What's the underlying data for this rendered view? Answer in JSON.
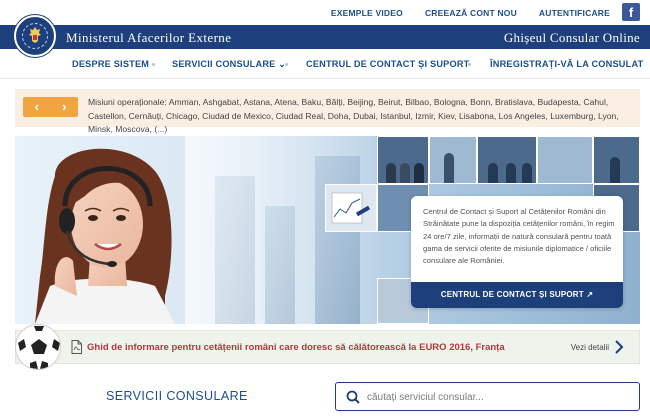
{
  "topbar": {
    "links": [
      "EXEMPLE VIDEO",
      "CREEAZĂ CONT NOU",
      "AUTENTIFICARE"
    ],
    "facebook_glyph": "f"
  },
  "header": {
    "ministry": "Ministerul Afacerilor Externe",
    "portal": "Ghișeul Consular Online",
    "crest_icon": "romanian-coat-of-arms",
    "crest_text": "GUVERNUL ROMÂNIEI"
  },
  "nav": {
    "items": [
      "DESPRE SISTEM",
      "SERVICII CONSULARE",
      "CENTRUL DE CONTACT ȘI SUPORT",
      "ÎNREGISTRAȚI-VĂ LA CONSULAT"
    ],
    "dropdown_glyph": "⌄"
  },
  "ticker": {
    "prev_glyph": "‹",
    "next_glyph": "›",
    "text": "Misiuni operaționale: Amman, Ashgabat, Astana, Atena, Baku, Bălți, Beijing, Beirut, Bilbao, Bologna, Bonn, Bratislava, Budapesta, Cahul, Castellon, Cernăuți, Chicago, Ciudad de Mexico, Ciudad Real, Doha, Dubai, Istanbul, Izmir, Kiev, Lisabona, Los Angeles, Luxemburg, Lyon, Minsk, Moscova, (...)"
  },
  "hero": {
    "card_text": "Centrul de Contact și Suport al Cetățenilor Români din Străinătate pune la dispoziția cetățenilor români, în regim 24 ore/7 zile, informații de natură consulară pentru toată gama de servicii oferite de misiunile diplomatice / oficiile consulare ale României.",
    "card_button": "CENTRUL DE CONTACT ȘI SUPORT",
    "external_glyph": "↗"
  },
  "guide": {
    "text": "Ghid de informare pentru cetățenii români care doresc să călătorească la EURO 2016, Franța",
    "more": "Vezi detalii"
  },
  "services": {
    "title": "SERVICII CONSULARE"
  },
  "search": {
    "placeholder": "căutați serviciul consular..."
  },
  "colors": {
    "brand_blue": "#1d3f7c",
    "link_blue": "#1a4f8f",
    "ticker_orange": "#f0a540",
    "guide_red": "#b03a3a"
  }
}
